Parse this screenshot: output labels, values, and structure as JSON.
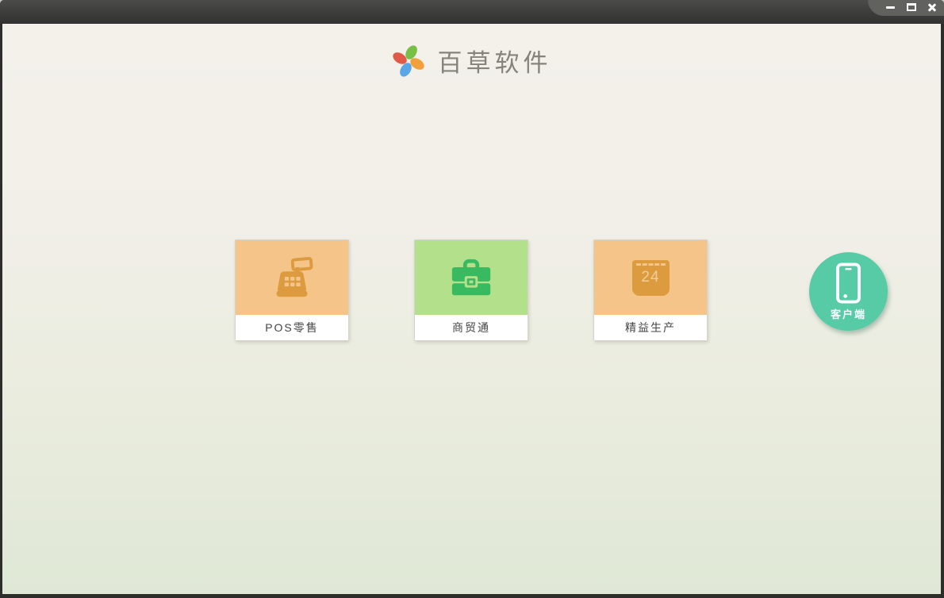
{
  "window": {
    "controls": [
      {
        "name": "minimize",
        "icon": "minimize-icon"
      },
      {
        "name": "maximize",
        "icon": "maximize-icon"
      },
      {
        "name": "close",
        "icon": "close-icon"
      }
    ],
    "frame_color": "#2d2d2b",
    "titlebar_color": "#3c3c3a"
  },
  "header": {
    "app_name": "百草软件",
    "logo_icon": "pinwheel-icon",
    "logo_petal_colors": [
      "#77c043",
      "#f2a03d",
      "#58a5e8",
      "#e15a47"
    ]
  },
  "products": [
    {
      "label": "POS零售",
      "icon": "cash-register-icon",
      "tile_color": "#f5c489",
      "icon_color": "#dd9b3f"
    },
    {
      "label": "商贸通",
      "icon": "briefcase-icon",
      "tile_color": "#b3e08a",
      "icon_color": "#3aba60"
    },
    {
      "label": "精益生产",
      "icon": "calendar-icon",
      "calendar_day": "24",
      "tile_color": "#f5c489",
      "icon_color": "#dd9b3f"
    }
  ],
  "client_launcher": {
    "label": "客户端",
    "icon": "smartphone-icon",
    "color": "#57cba6"
  }
}
